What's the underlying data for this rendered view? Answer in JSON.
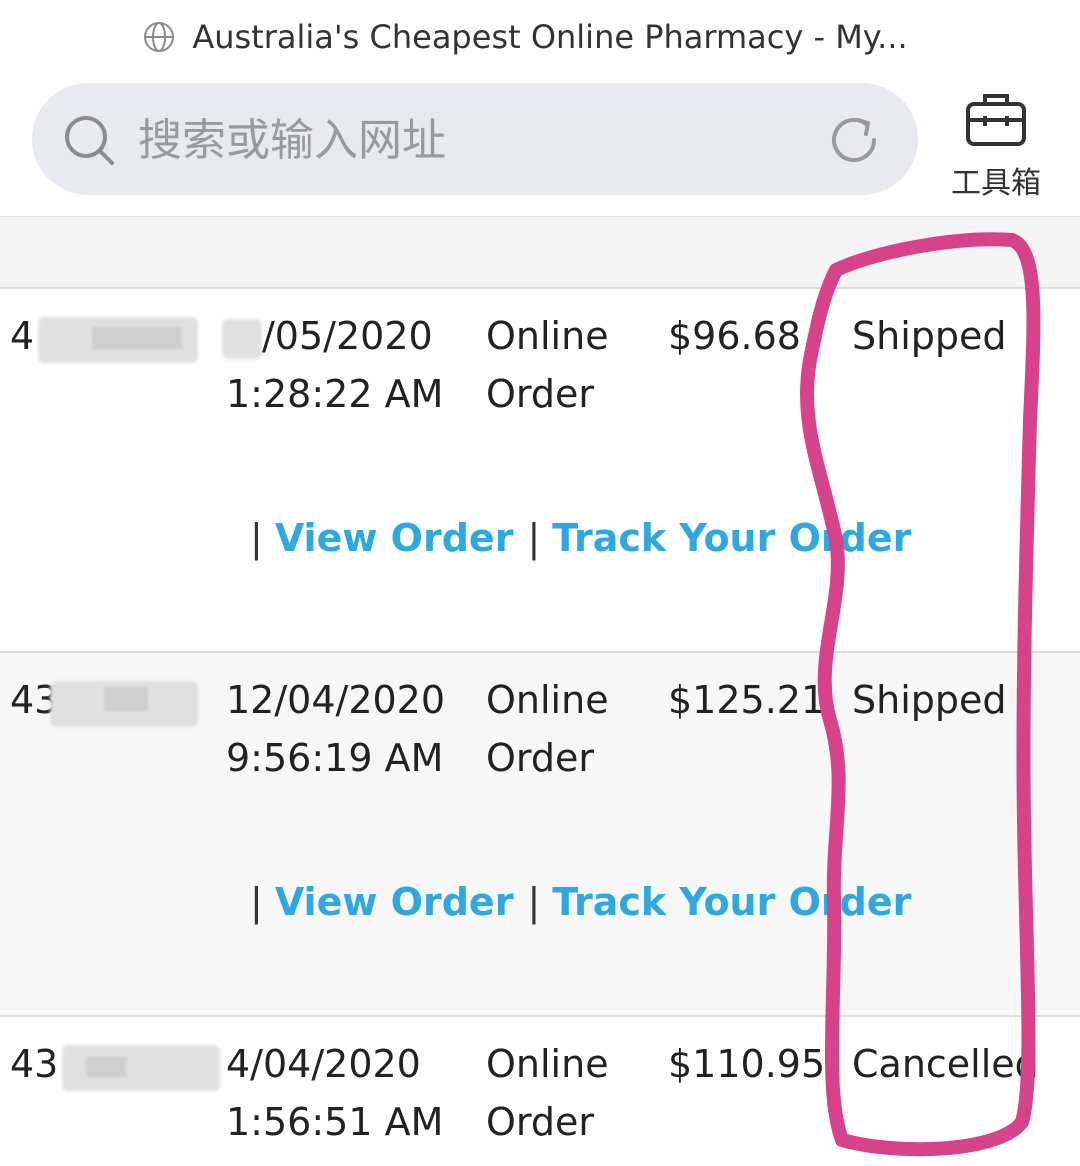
{
  "browser": {
    "page_title": "Australia's Cheapest Online Pharmacy - My...",
    "search_placeholder": "搜索或输入网址",
    "toolbox_label": "工具箱"
  },
  "orders": [
    {
      "id": "4",
      "date": "/05/2020",
      "time": "1:28:22 AM",
      "type_line1": "Online",
      "type_line2": "Order",
      "total": "$96.68",
      "status": "Shipped",
      "sep": "|",
      "view_label": "View Order",
      "track_label": "Track Your Order"
    },
    {
      "id": "43",
      "date": "12/04/2020",
      "time": "9:56:19 AM",
      "type_line1": "Online",
      "type_line2": "Order",
      "total": "$125.21",
      "status": "Shipped",
      "sep": "|",
      "view_label": "View Order",
      "track_label": "Track Your Order"
    },
    {
      "id": "43",
      "date": "4/04/2020",
      "time": "1:56:51 AM",
      "type_line1": "Online",
      "type_line2": "Order",
      "total": "$110.95",
      "status": "Cancelled",
      "sep": "|",
      "view_label": "View Order",
      "track_label": "Track Your Order"
    }
  ],
  "colors": {
    "link": "#2ea8e0",
    "annotation": "#d6438a",
    "search_bg": "#e8eaf0"
  },
  "icons": [
    "globe-icon",
    "search-icon",
    "refresh-icon",
    "toolbox-icon"
  ]
}
